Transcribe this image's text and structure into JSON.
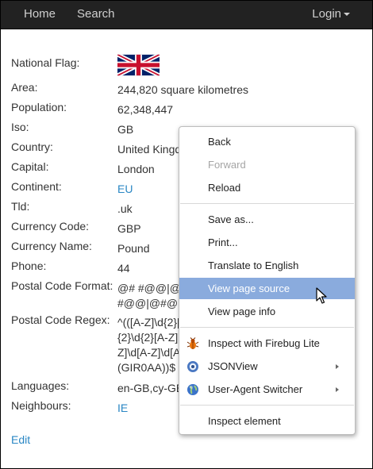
{
  "nav": {
    "home": "Home",
    "search": "Search",
    "login": "Login"
  },
  "details": {
    "national_flag_label": "National Flag:",
    "rows": [
      {
        "label": "Area:",
        "value": "244,820 square kilometres"
      },
      {
        "label": "Population:",
        "value": "62,348,447"
      },
      {
        "label": "Iso:",
        "value": "GB"
      },
      {
        "label": "Country:",
        "value": "United Kingdom"
      },
      {
        "label": "Capital:",
        "value": "London"
      },
      {
        "label": "Continent:",
        "value": "EU"
      },
      {
        "label": "Tld:",
        "value": ".uk"
      },
      {
        "label": "Currency Code:",
        "value": "GBP"
      },
      {
        "label": "Currency Name:",
        "value": "Pound"
      },
      {
        "label": "Phone:",
        "value": "44"
      },
      {
        "label": "Postal Code Format:",
        "value_lines": [
          "@# #@@|@##",
          "#@@|@#@"
        ]
      },
      {
        "label": "Postal Code Regex:",
        "value_lines": [
          "^(([A-Z]\\d{2}[A-Z]",
          "{2}\\d{2}[A-Z]",
          "Z]\\d[A-Z]\\d[A-Z]",
          "(GIR0AA))$"
        ]
      },
      {
        "label": "Languages:",
        "value": "en-GB,cy-GB,gd"
      },
      {
        "label": "Neighbours:",
        "value": "IE"
      }
    ]
  },
  "edit_link": "Edit",
  "context_menu": {
    "items": [
      {
        "label": "Back"
      },
      {
        "label": "Forward",
        "disabled": true
      },
      {
        "label": "Reload"
      },
      {
        "label": "Save as..."
      },
      {
        "label": "Print..."
      },
      {
        "label": "Translate to English"
      },
      {
        "label": "View page source",
        "selected": true
      },
      {
        "label": "View page info"
      },
      {
        "label": "Inspect with Firebug Lite",
        "icon": "firebug-icon"
      },
      {
        "label": "JSONView",
        "icon": "jsonview-icon"
      },
      {
        "label": "User-Agent Switcher",
        "icon": "globe-icon"
      },
      {
        "label": "Inspect element"
      }
    ]
  },
  "colors": {
    "link": "#2a87c4",
    "navbar": "#222222",
    "menu_highlight": "#8aabdd"
  }
}
